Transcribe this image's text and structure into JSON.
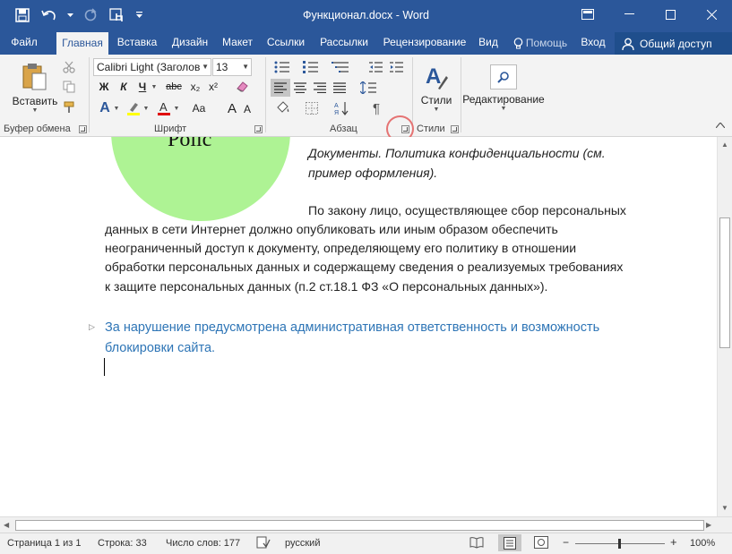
{
  "titlebar": {
    "title": "Функционал.docx - Word",
    "bg": "#2b579a"
  },
  "tabs": [
    {
      "label": "Файл"
    },
    {
      "label": "Главная",
      "active": true
    },
    {
      "label": "Вставка"
    },
    {
      "label": "Дизайн"
    },
    {
      "label": "Макет"
    },
    {
      "label": "Ссылки"
    },
    {
      "label": "Рассылки"
    },
    {
      "label": "Рецензирование"
    },
    {
      "label": "Вид"
    },
    {
      "label": "Помощь"
    },
    {
      "label": "Вход"
    }
  ],
  "share_label": "Общий доступ",
  "ribbon": {
    "paste_label": "Вставить",
    "font_name": "Calibri Light (Заголов",
    "font_size": "13",
    "groups": {
      "clipboard": "Буфер обмена",
      "font": "Шрифт",
      "paragraph": "Абзац",
      "styles": "Стили"
    },
    "styles_label": "Стили",
    "editing_label": "Редактирование",
    "format_buttons": {
      "bold": "Ж",
      "italic": "К",
      "underline": "Ч",
      "strike": "abc",
      "subscript": "x₂",
      "superscript": "x²",
      "grow": "A",
      "shrink": "A",
      "aa": "Aa",
      "pilcrow": "¶"
    }
  },
  "document": {
    "circle_text": "Polic",
    "italic_lines": [
      "Документы. Политика конфиденциальности (см.",
      "пример оформления)."
    ],
    "body_lines": [
      "По закону лицо, осуществляющее сбор персональных",
      "данных в сети Интернет должно опубликовать или иным образом обеспечить",
      "неограниченный доступ к документу, определяющему его политику в отношении",
      "обработки персональных данных и содержащему сведения о реализуемых требованиях",
      "к защите персональных данных (п.2 ст.18.1 ФЗ «О персональных данных»)."
    ],
    "heading_lines": [
      "За нарушение предусмотрена административная ответственность и возможность",
      "блокировки сайта."
    ],
    "circle_color": "#aef394",
    "heading_color": "#2e75b6"
  },
  "statusbar": {
    "page": "Страница 1 из 1",
    "line": "Строка: 33",
    "words": "Число слов: 177",
    "language": "русский",
    "zoom": "100%"
  }
}
